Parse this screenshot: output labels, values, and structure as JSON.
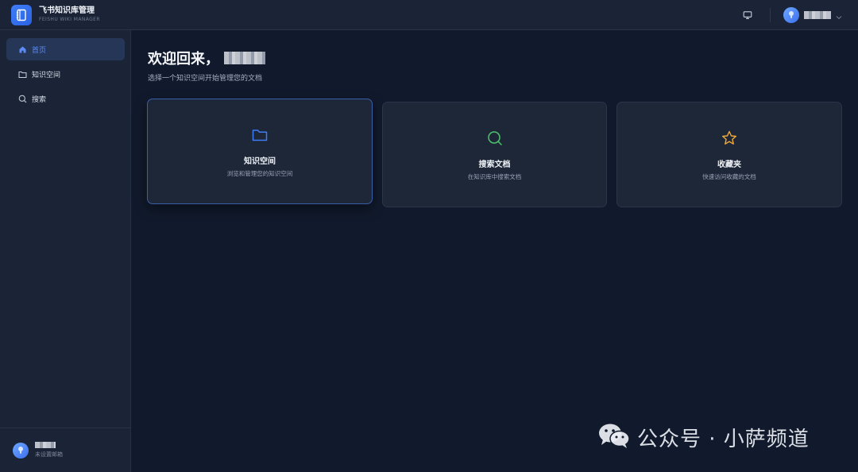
{
  "brand": {
    "title": "飞书知识库管理",
    "subtitle": "FEISHU WIKI MANAGER"
  },
  "header": {
    "monitor_icon": "monitor-icon",
    "user_avatar_icon": "user-avatar-icon",
    "user_name": "",
    "dropdown_icon": "chevron-down-icon"
  },
  "sidebar": {
    "items": [
      {
        "label": "首页",
        "icon": "home-icon",
        "active": true
      },
      {
        "label": "知识空间",
        "icon": "folder-icon",
        "active": false
      },
      {
        "label": "搜索",
        "icon": "search-icon",
        "active": false
      }
    ],
    "footer": {
      "user_name": "",
      "email": "未设置邮箱"
    }
  },
  "main": {
    "greeting": "欢迎回来，",
    "subtitle": "选择一个知识空间开始管理您的文档",
    "cards": [
      {
        "title": "知识空间",
        "description": "浏览和管理您的知识空间",
        "icon": "folder-icon",
        "color": "#3f7df7"
      },
      {
        "title": "搜索文档",
        "description": "在知识库中搜索文档",
        "icon": "search-icon",
        "color": "#4cc46a"
      },
      {
        "title": "收藏夹",
        "description": "快速访问收藏的文档",
        "icon": "star-icon",
        "color": "#f0a93a"
      }
    ]
  },
  "watermark": {
    "text": "公众号 · 小萨频道",
    "icon": "wechat-icon"
  },
  "colors": {
    "accent": "#3f7df7",
    "background": "#111a2c",
    "sidebar": "#1b2436"
  }
}
